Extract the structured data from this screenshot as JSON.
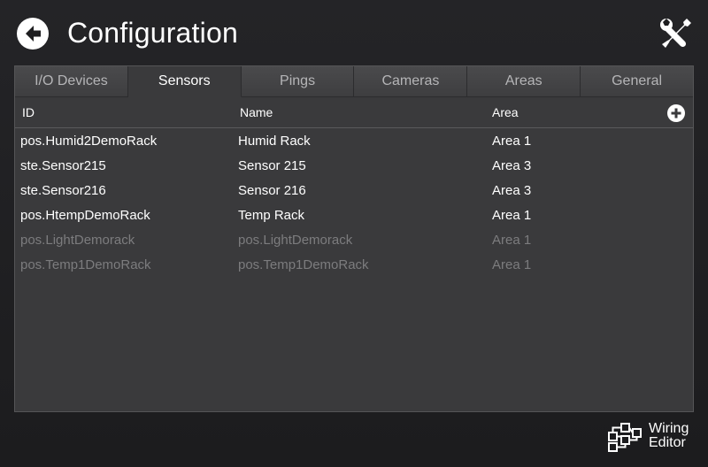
{
  "header": {
    "title": "Configuration",
    "back_icon": "back-arrow-icon",
    "tools_icon": "wrench-screwdriver-icon"
  },
  "tabs": [
    {
      "label": "I/O Devices",
      "active": false
    },
    {
      "label": "Sensors",
      "active": true
    },
    {
      "label": "Pings",
      "active": false
    },
    {
      "label": "Cameras",
      "active": false
    },
    {
      "label": "Areas",
      "active": false
    },
    {
      "label": "General",
      "active": false
    }
  ],
  "table": {
    "columns": {
      "id": "ID",
      "name": "Name",
      "area": "Area"
    },
    "add_icon": "plus-circle-icon",
    "rows": [
      {
        "id": "pos.Humid2DemoRack",
        "name": "Humid Rack",
        "area": "Area 1",
        "enabled": true
      },
      {
        "id": "ste.Sensor215",
        "name": "Sensor 215",
        "area": "Area 3",
        "enabled": true
      },
      {
        "id": "ste.Sensor216",
        "name": "Sensor 216",
        "area": "Area 3",
        "enabled": true
      },
      {
        "id": "pos.HtempDemoRack",
        "name": "Temp Rack",
        "area": "Area 1",
        "enabled": true
      },
      {
        "id": "pos.LightDemorack",
        "name": "pos.LightDemorack",
        "area": "Area 1",
        "enabled": false
      },
      {
        "id": "pos.Temp1DemoRack",
        "name": "pos.Temp1DemoRack",
        "area": "Area 1",
        "enabled": false
      }
    ]
  },
  "footer": {
    "wiring_label_line1": "Wiring",
    "wiring_label_line2": "Editor",
    "wiring_icon": "wiring-diagram-icon"
  },
  "colors": {
    "background": "#1e1e20",
    "panel": "#3a3a3c",
    "text": "#ffffff",
    "disabled_text": "#7c7c7e"
  }
}
